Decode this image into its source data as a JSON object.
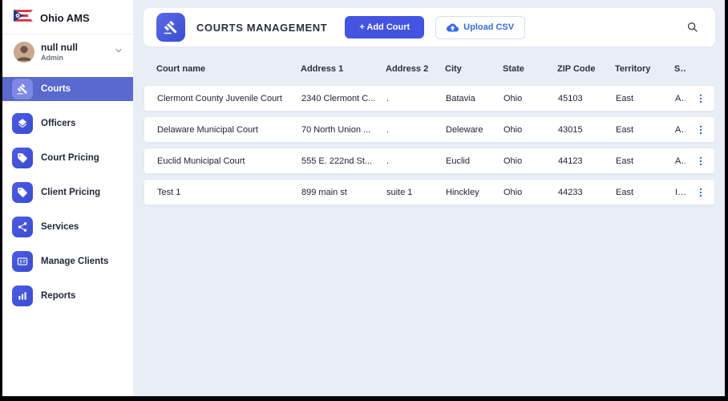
{
  "app": {
    "title": "Ohio AMS"
  },
  "user": {
    "name": "null null",
    "role": "Admin"
  },
  "sidebar": {
    "items": [
      {
        "label": "Courts",
        "icon": "gavel-icon",
        "active": true
      },
      {
        "label": "Officers",
        "icon": "layers-icon",
        "active": false
      },
      {
        "label": "Court Pricing",
        "icon": "tag-icon",
        "active": false
      },
      {
        "label": "Client Pricing",
        "icon": "tag-icon",
        "active": false
      },
      {
        "label": "Services",
        "icon": "share-icon",
        "active": false
      },
      {
        "label": "Manage Clients",
        "icon": "id-card-icon",
        "active": false
      },
      {
        "label": "Reports",
        "icon": "bar-chart-icon",
        "active": false
      }
    ]
  },
  "header": {
    "title": "COURTS MANAGEMENT",
    "add_button_label": "+ Add Court",
    "upload_button_label": "Upload CSV"
  },
  "table": {
    "columns": [
      "Court name",
      "Address 1",
      "Address 2",
      "City",
      "State",
      "ZIP Code",
      "Territory",
      "Status"
    ],
    "rows": [
      [
        "Clermont County Juvenile Court",
        "2340 Clermont C...",
        ".",
        "Batavia",
        "Ohio",
        "45103",
        "East",
        "Active"
      ],
      [
        "Delaware Municipal Court",
        "70 North Union ...",
        ".",
        "Deleware",
        "Ohio",
        "43015",
        "East",
        "Active"
      ],
      [
        "Euclid Municipal Court",
        "555 E. 222nd St...",
        ".",
        "Euclid",
        "Ohio",
        "44123",
        "East",
        "Active"
      ],
      [
        "Test 1",
        "899 main st",
        "suite 1",
        "Hinckley",
        "Ohio",
        "44233",
        "East",
        "Inactive"
      ]
    ]
  },
  "colors": {
    "accent": "#4353e2",
    "sidebar_active": "#5a69ce",
    "main_bg": "#e9edf6",
    "kebab_blue": "#2e62e8"
  }
}
